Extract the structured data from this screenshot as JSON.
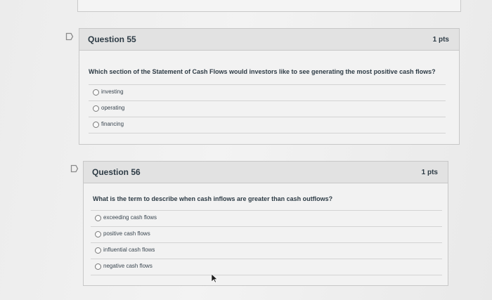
{
  "questions": [
    {
      "title": "Question 55",
      "points": "1 pts",
      "text": "Which section of the Statement of Cash Flows would investors like to see generating the most positive cash flows?",
      "answers": [
        "investing",
        "operating",
        "financing"
      ]
    },
    {
      "title": "Question 56",
      "points": "1 pts",
      "text": "What is the term to describe when cash inflows are greater than cash outflows?",
      "answers": [
        "exceeding cash flows",
        "positive cash flows",
        "influential cash flows",
        "negative cash flows"
      ]
    }
  ],
  "icons": {
    "flag": "flag-icon",
    "radio": "radio-button",
    "cursor": "mouse-pointer-icon"
  },
  "colors": {
    "header_bg": "#e2e2e2",
    "body_bg": "#f2f2f2",
    "text": "#2d3b45",
    "border": "#c7c7c7"
  }
}
